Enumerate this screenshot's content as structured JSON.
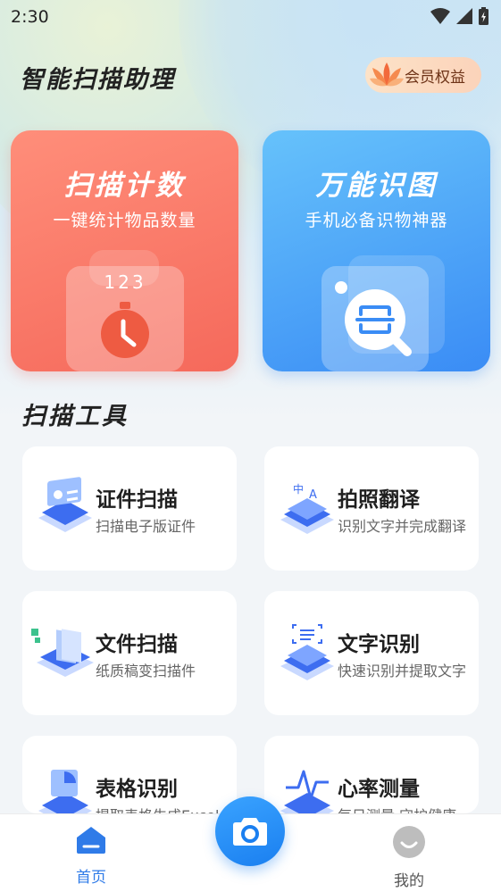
{
  "status_bar": {
    "time": "2:30"
  },
  "header": {
    "title": "智能扫描助理",
    "vip_label": "会员权益"
  },
  "feature_cards": [
    {
      "title": "扫描计数",
      "subtitle": "一键统计物品数量",
      "icon_text": "123",
      "icon": "stopwatch-icon",
      "color": "#f5695b"
    },
    {
      "title": "万能识图",
      "subtitle": "手机必备识物神器",
      "icon": "image-search-icon",
      "color": "#3a8cf5"
    }
  ],
  "tools_section": {
    "title": "扫描工具",
    "items": [
      {
        "name": "证件扫描",
        "desc": "扫描电子版证件",
        "icon": "id-card-scan-icon"
      },
      {
        "name": "拍照翻译",
        "desc": "识别文字并完成翻译",
        "icon": "photo-translate-icon"
      },
      {
        "name": "文件扫描",
        "desc": "纸质稿变扫描件",
        "icon": "document-scan-icon"
      },
      {
        "name": "文字识别",
        "desc": "快速识别并提取文字",
        "icon": "text-recognition-icon"
      },
      {
        "name": "表格识别",
        "desc": "提取表格生成Excel",
        "icon": "table-recognition-icon"
      },
      {
        "name": "心率测量",
        "desc": "每日测量 守护健康",
        "icon": "heart-rate-icon"
      }
    ]
  },
  "bottom_nav": {
    "home_label": "首页",
    "mine_label": "我的",
    "active_color": "#2f7be8"
  }
}
